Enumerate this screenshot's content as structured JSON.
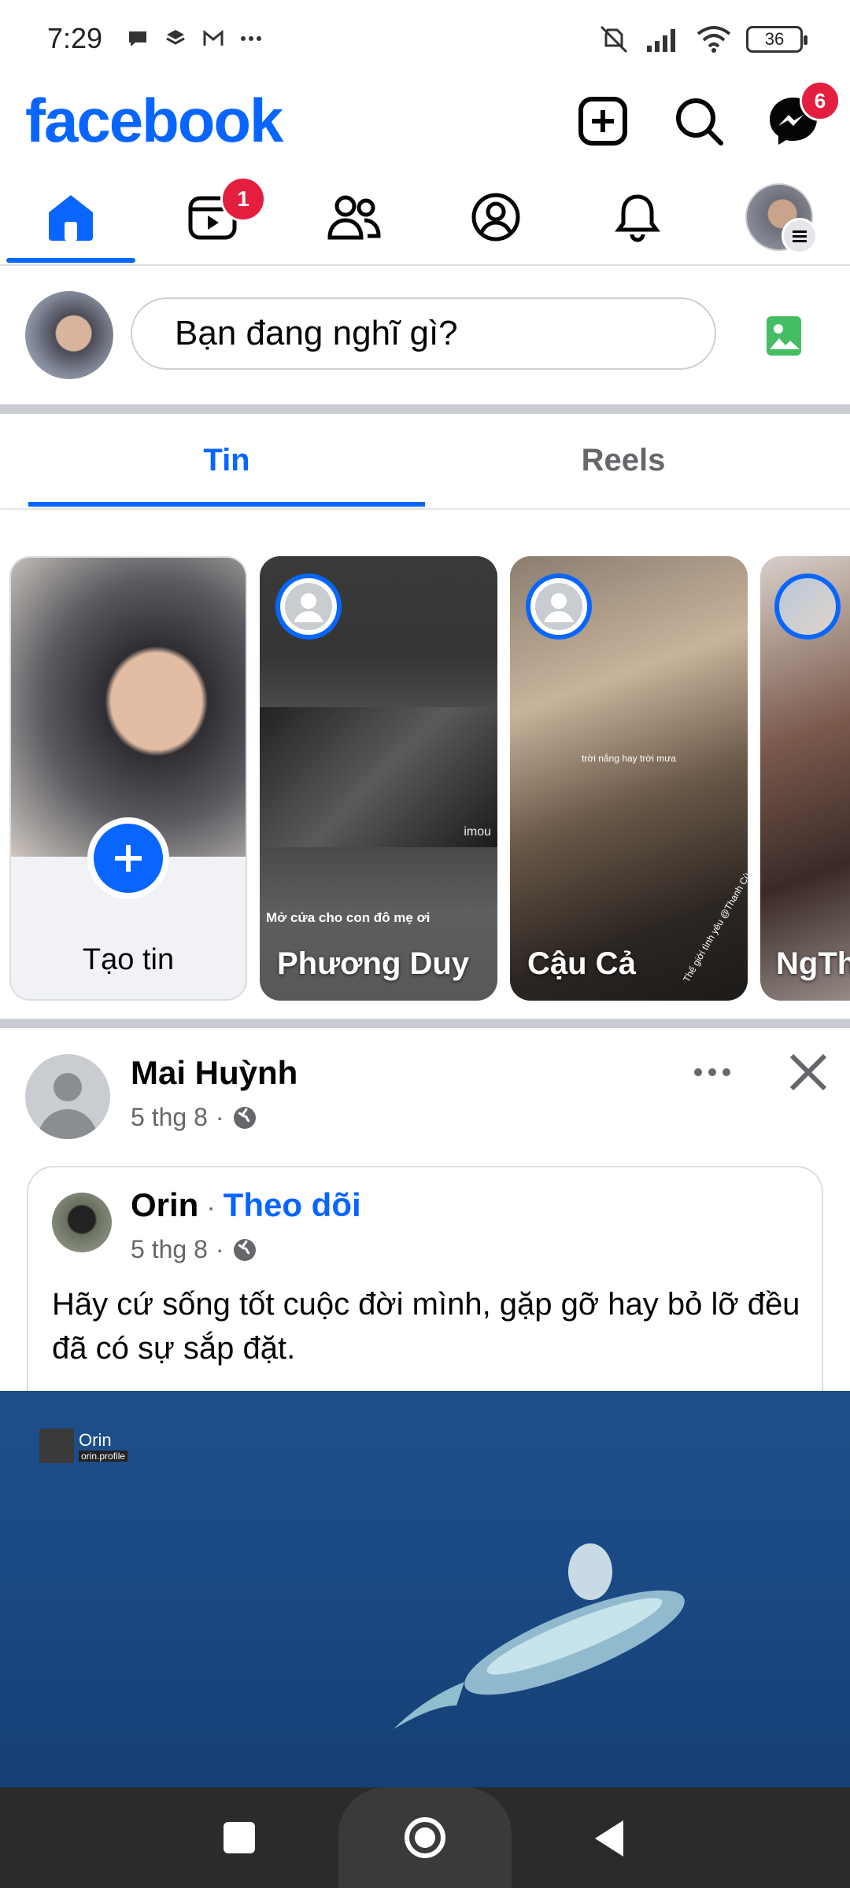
{
  "status_bar": {
    "time": "7:29",
    "battery": "36"
  },
  "header": {
    "logo": "facebook",
    "messenger_badge": "6"
  },
  "nav": {
    "reels_badge": "1"
  },
  "composer": {
    "placeholder": "Bạn đang nghĩ gì?"
  },
  "tabs": [
    {
      "label": "Tin",
      "active": true
    },
    {
      "label": "Reels",
      "active": false
    }
  ],
  "stories": [
    {
      "name": "Tạo tin",
      "type": "create"
    },
    {
      "name": "Phương Duy",
      "caption": "Mở cửa cho con đô mẹ ơi",
      "watermark": "imou"
    },
    {
      "name": "Cậu Cả",
      "caption": "trời nắng hay trời mưa",
      "caption2": "Thế giới tình yêu",
      "caption3": "@Thanh Cù"
    },
    {
      "name": "NgTh"
    }
  ],
  "post": {
    "author": "Mai Huỳnh",
    "date": "5 thg 8",
    "dot": "·",
    "shared": {
      "author": "Orin",
      "follow_sep": "·",
      "follow": "Theo dõi",
      "date": "5 thg 8",
      "text": "Hãy cứ sống tốt cuộc đời mình, gặp gỡ hay bỏ lỡ đều đã có sự sắp đặt.",
      "video_tag_name": "Orin",
      "video_tag_sub": "orin.profile"
    }
  },
  "colors": {
    "brand": "#0866ff",
    "badge": "#e41e3f",
    "photo_green": "#45bd62"
  }
}
